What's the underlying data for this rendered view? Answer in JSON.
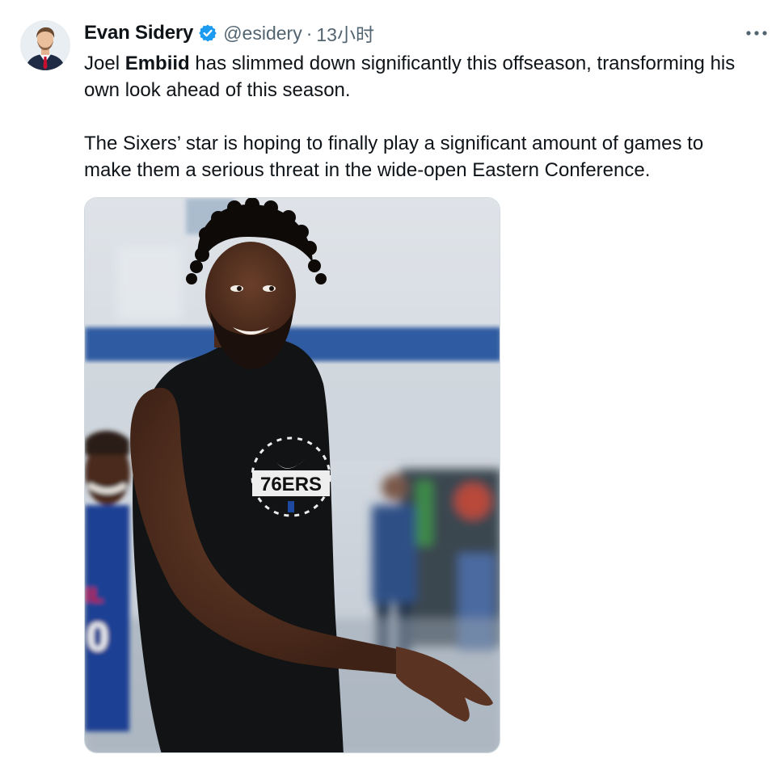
{
  "tweet": {
    "author": {
      "display_name": "Evan Sidery",
      "handle": "@esidery",
      "verified": true
    },
    "separator": "·",
    "time": "13小时",
    "more_icon": "more-horizontal-icon",
    "text": {
      "p1_prefix": "Joel ",
      "p1_bold": "Embiid",
      "p1_rest": " has slimmed down significantly this offseason, transforming his own look ahead of this season.",
      "p2": "The Sixers’ star is hoping to finally play a significant amount of games to make them a serious threat in the wide-open Eastern Conference."
    },
    "photo": {
      "shirt_text": "76ERS"
    }
  },
  "colors": {
    "text_primary": "#0f1419",
    "text_secondary": "#536471",
    "verified_blue": "#1d9bf0",
    "border": "#cfd9de"
  }
}
